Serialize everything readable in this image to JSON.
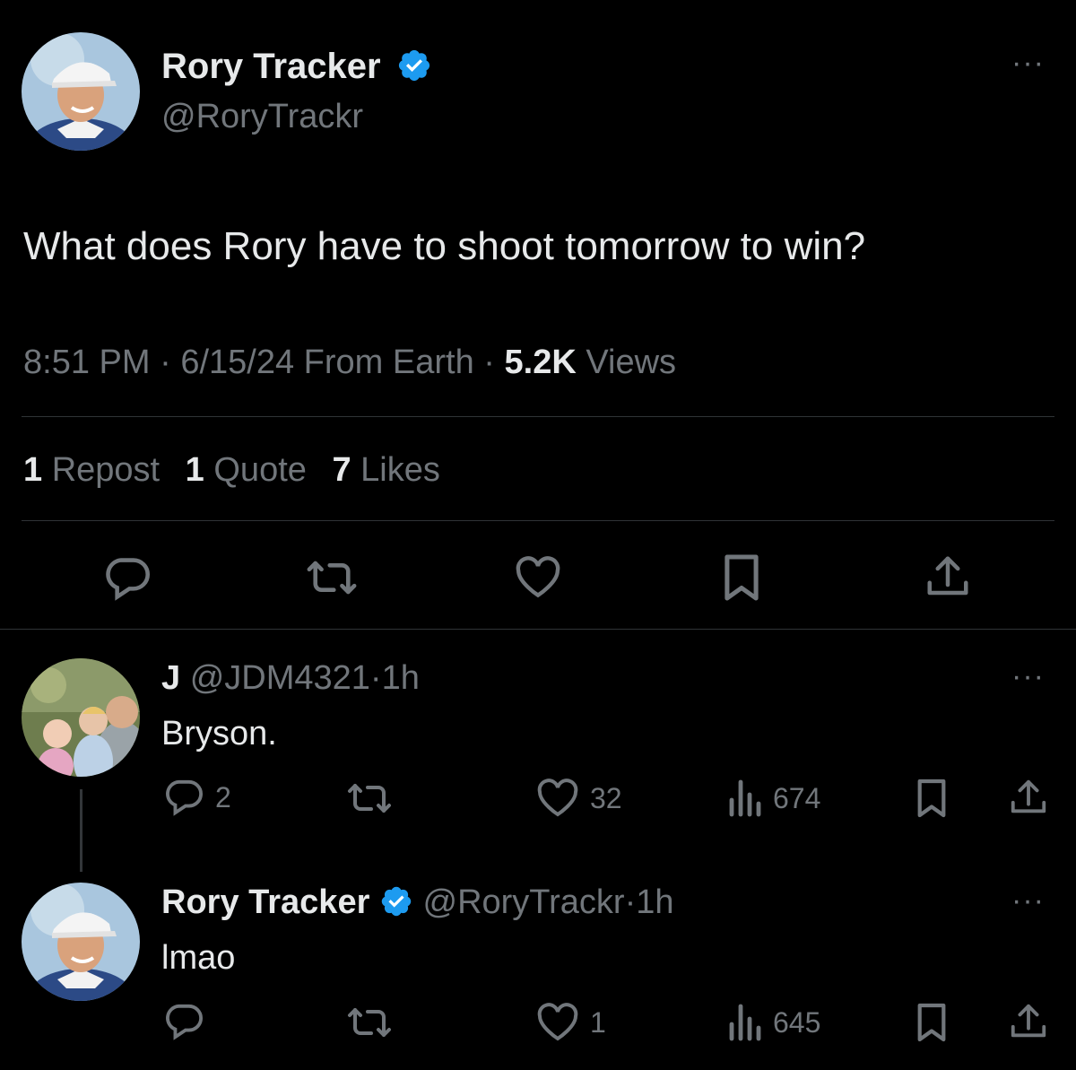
{
  "main": {
    "name": "Rory Tracker",
    "handle": "@RoryTrackr",
    "text": "What does Rory have to shoot tomorrow to win?",
    "time": "8:51 PM",
    "date": "6/15/24",
    "source": "From Earth",
    "views_count": "5.2K",
    "views_label": "Views",
    "reposts_count": "1",
    "reposts_label": "Repost",
    "quotes_count": "1",
    "quotes_label": "Quote",
    "likes_count": "7",
    "likes_label": "Likes",
    "more": "···"
  },
  "reply1": {
    "name": "J",
    "handle": "@JDM4321",
    "age": "1h",
    "text": "Bryson.",
    "replies": "2",
    "likes": "32",
    "views": "674",
    "more": "···"
  },
  "reply2": {
    "name": "Rory Tracker",
    "handle": "@RoryTrackr",
    "age": "1h",
    "text": "lmao",
    "likes": "1",
    "views": "645",
    "more": "···"
  },
  "separator": "·",
  "colors": {
    "background": "#000000",
    "text": "#e7e9ea",
    "muted": "#71767b",
    "verified": "#1d9bf0",
    "divider": "#2f3336"
  },
  "icons": [
    "reply-icon",
    "repost-icon",
    "like-icon",
    "bookmark-icon",
    "share-icon",
    "views-icon",
    "verified-icon",
    "more-icon"
  ]
}
